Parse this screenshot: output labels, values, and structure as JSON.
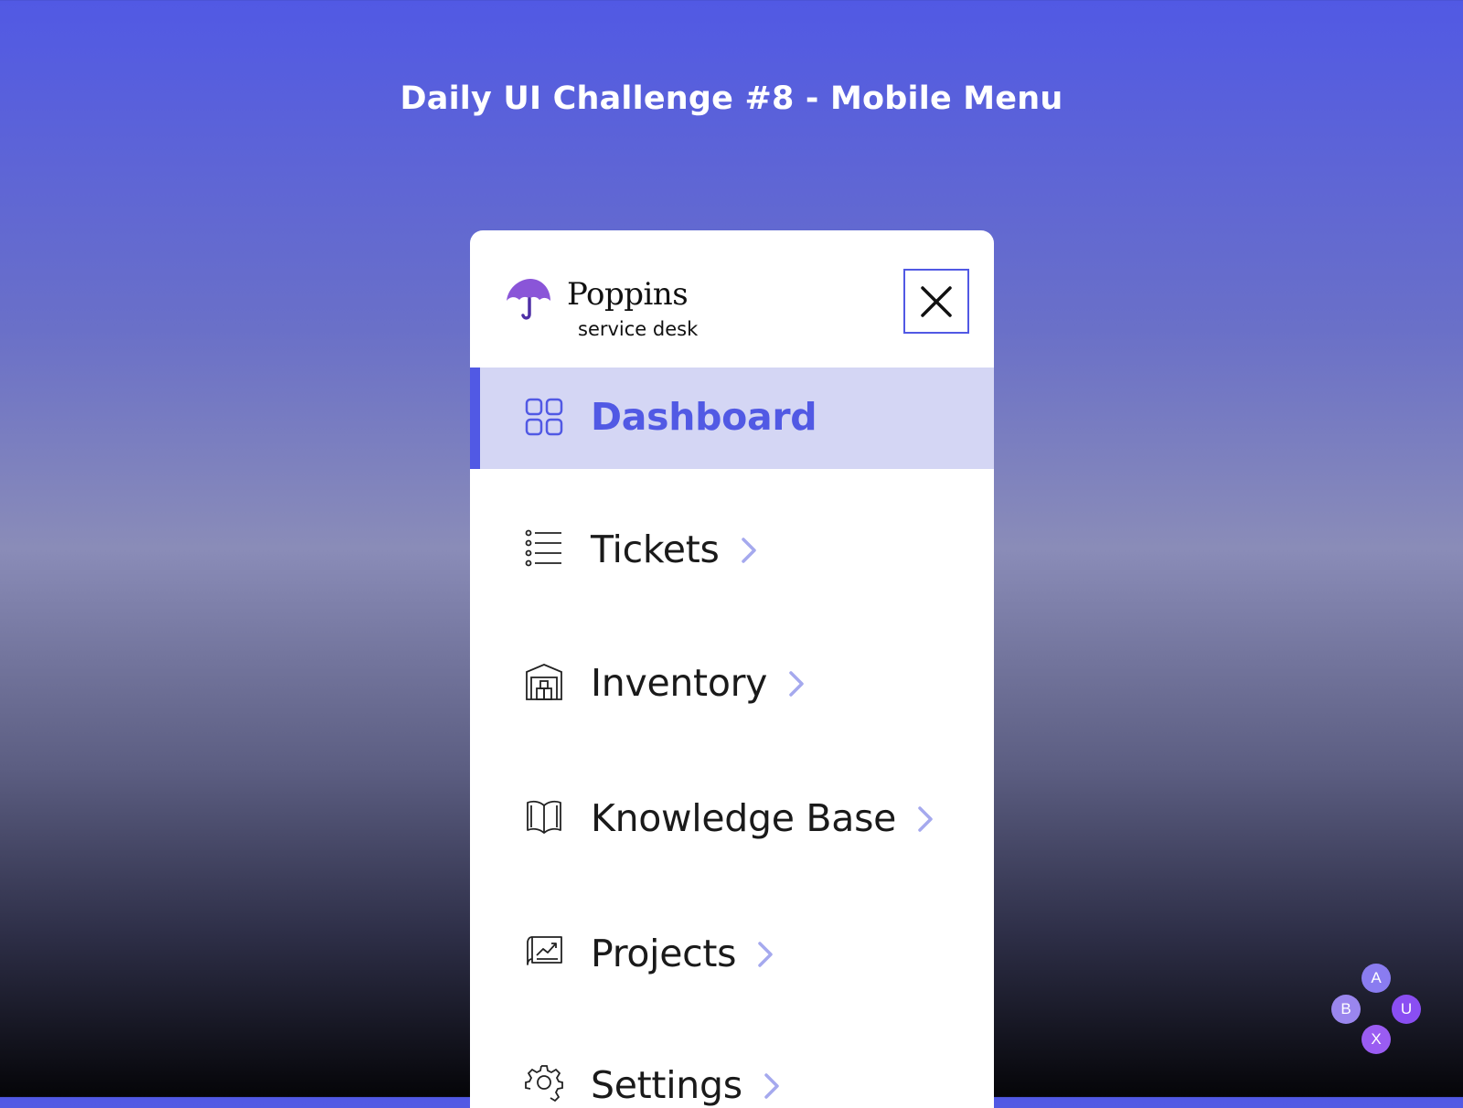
{
  "page": {
    "title": "Daily UI Challenge #8 - Mobile Menu"
  },
  "brand": {
    "name": "Poppins",
    "tagline": "service desk",
    "logo_icon": "umbrella-icon",
    "accent_color": "#5159e4",
    "logo_color": "#8a55d8"
  },
  "close_button": {
    "icon": "close-icon"
  },
  "menu": {
    "items": [
      {
        "label": "Dashboard",
        "icon": "grid-icon",
        "active": true
      },
      {
        "label": "Tickets",
        "icon": "list-icon",
        "active": false
      },
      {
        "label": "Inventory",
        "icon": "warehouse-icon",
        "active": false
      },
      {
        "label": "Knowledge Base",
        "icon": "book-icon",
        "active": false
      },
      {
        "label": "Projects",
        "icon": "chart-board-icon",
        "active": false
      },
      {
        "label": "Settings",
        "icon": "gear-icon",
        "active": false
      }
    ],
    "chevron_icon": "chevron-right-icon",
    "chevron_color": "#a5a9ee",
    "active_background": "#d4d6f4"
  },
  "badges": [
    "A",
    "B",
    "U",
    "X"
  ]
}
